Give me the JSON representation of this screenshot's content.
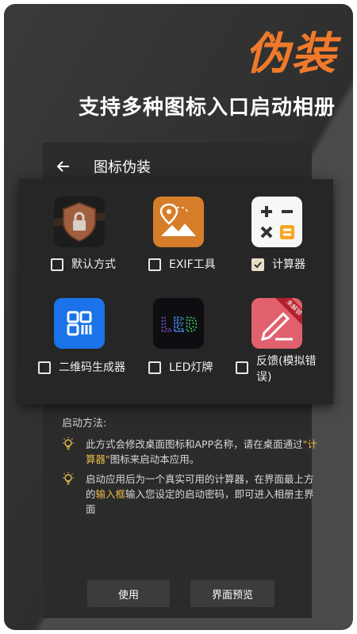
{
  "hero": {
    "title": "伪装",
    "subtitle": "支持多种图标入口启动相册"
  },
  "appbar": {
    "title": "图标伪装"
  },
  "options": [
    {
      "label": "默认方式",
      "checked": false,
      "icon": "shield-lock-icon"
    },
    {
      "label": "EXIF工具",
      "checked": false,
      "icon": "map-pin-image-icon"
    },
    {
      "label": "计算器",
      "checked": true,
      "icon": "calculator-icon"
    },
    {
      "label": "二维码生成器",
      "checked": false,
      "icon": "qr-code-icon"
    },
    {
      "label": "LED灯牌",
      "checked": false,
      "icon": "led-board-icon"
    },
    {
      "label": "反馈(模拟错误)",
      "checked": false,
      "icon": "feedback-pencil-icon",
      "badge": "未解锁"
    }
  ],
  "info": {
    "title": "启动方法:",
    "tip1": {
      "pre": "此方式会修改桌面图标和APP名称，请在桌面通过",
      "hl": "\"计算器\"",
      "post": "图标来启动本应用。"
    },
    "tip2": {
      "pre": "启动应用后为一个真实可用的计算器，在界面最上方的",
      "hl": "输入框",
      "post": "输入您设定的启动密码，即可进入相册主界面"
    }
  },
  "buttons": {
    "use": "使用",
    "preview": "界面预览"
  },
  "colors": {
    "accent": "#f07a2a",
    "highlight": "#e8b84a",
    "calc_orange": "#f5a623",
    "qr_blue": "#1a73e8",
    "feedback_red": "#e0616d"
  }
}
